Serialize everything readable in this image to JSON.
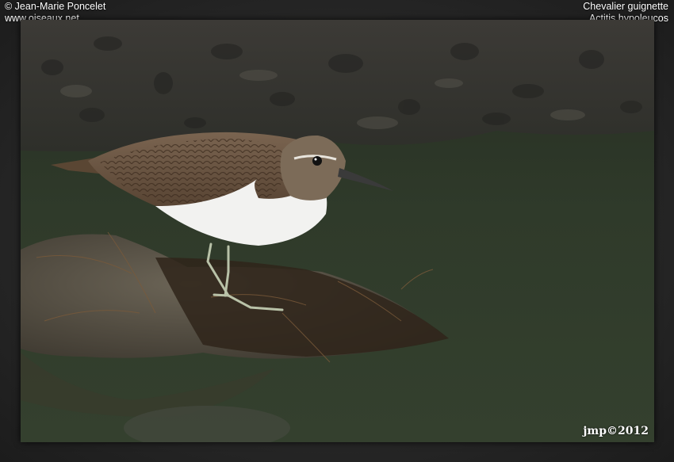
{
  "credits": {
    "author": "© Jean-Marie Poncelet",
    "website": "www.oiseaux.net"
  },
  "species": {
    "common_name": "Chevalier guignette",
    "scientific_name": "Actitis hypoleucos"
  },
  "watermark": "jmp©2012",
  "colors": {
    "water": "#2f3a2a",
    "mud": "#3a3834",
    "bird_back": "#6b5440",
    "bird_belly": "#f2f2f0"
  }
}
